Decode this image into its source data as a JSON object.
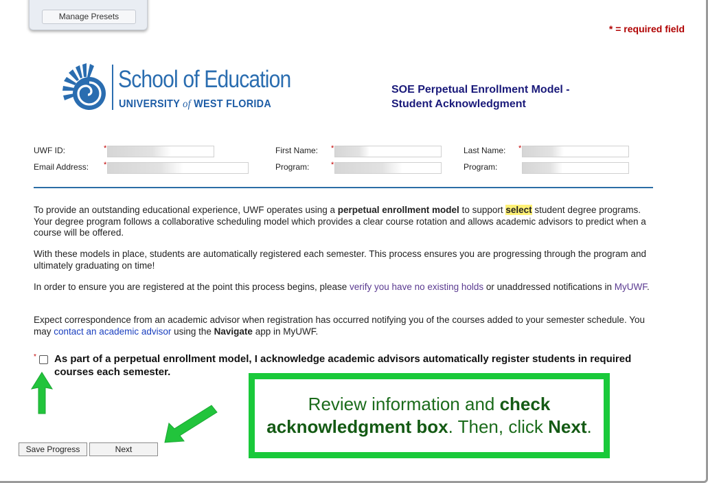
{
  "toolbar": {
    "manage_presets": "Manage Presets"
  },
  "required_note": "* = required field",
  "logo": {
    "title": "School of Education",
    "sub_pre": "UNIVERSITY",
    "sub_of": "of",
    "sub_post": "WEST FLORIDA"
  },
  "form": {
    "title_line1": "SOE Perpetual Enrollment Model -",
    "title_line2": "Student Acknowledgment"
  },
  "fields": {
    "uwf_id": "UWF ID:",
    "first_name": "First Name:",
    "last_name": "Last Name:",
    "email": "Email Address:",
    "program": "Program:",
    "program2": "Program:",
    "required_mark": "*"
  },
  "body": {
    "p1_a": "To provide an outstanding educational experience, UWF operates using a ",
    "p1_b": "perpetual enrollment model",
    "p1_c": " to support ",
    "p1_d": "select",
    "p1_e": " student degree programs. Your degree program follows a collaborative scheduling model which provides a clear course rotation and allows academic advisors to predict when a course will be offered.",
    "p2": "With these models in place, students are automatically registered each semester. This process ensures you are progressing through the program and ultimately graduating on time!",
    "p3_a": "In order to ensure you are registered at the point this process begins, please ",
    "p3_link": "verify you have no existing holds",
    "p3_b": " or unaddressed notifications in ",
    "p3_link2": "MyUWF",
    "p3_c": ".",
    "p4_a": "Expect correspondence from an academic advisor when registration has occurred notifying you of the courses added to your semester schedule. You may ",
    "p4_link": "contact an academic advisor",
    "p4_b": " using the ",
    "p4_c": "Navigate",
    "p4_d": " app in MyUWF."
  },
  "acknowledgment": {
    "required": "*",
    "text": "As part of a perpetual enrollment model, I acknowledge academic advisors automatically register students in required courses each semester.",
    "checked": false
  },
  "callout": {
    "a": "Review information and ",
    "b": "check acknowledgment box",
    "c": ". Then, click ",
    "d": "Next",
    "e": "."
  },
  "buttons": {
    "save_progress": "Save Progress",
    "next": "Next"
  },
  "colors": {
    "callout_border": "#19c93a",
    "arrow": "#22c43c",
    "title": "#1a1a7a",
    "required": "#b00000",
    "logo": "#2a6db0"
  }
}
